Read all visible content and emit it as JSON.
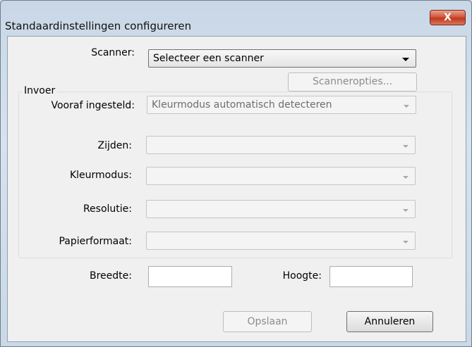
{
  "window": {
    "title": "Standaardinstellingen configureren",
    "close_glyph": "X"
  },
  "form": {
    "scanner": {
      "label": "Scanner:",
      "value": "Selecteer een scanner"
    },
    "scanner_options_button": "Scanneropties...",
    "preset": {
      "label": "Vooraf ingesteld:",
      "value": "Kleurmodus automatisch detecteren"
    },
    "input_group": {
      "label": "Invoer",
      "sides": {
        "label": "Zijden:",
        "value": ""
      },
      "color_mode": {
        "label": "Kleurmodus:",
        "value": ""
      },
      "resolution": {
        "label": "Resolutie:",
        "value": ""
      },
      "paper_size": {
        "label": "Papierformaat:",
        "value": ""
      },
      "width": {
        "label": "Breedte:",
        "value": ""
      },
      "height": {
        "label": "Hoogte:",
        "value": ""
      }
    }
  },
  "buttons": {
    "save": "Opslaan",
    "cancel": "Annuleren"
  }
}
